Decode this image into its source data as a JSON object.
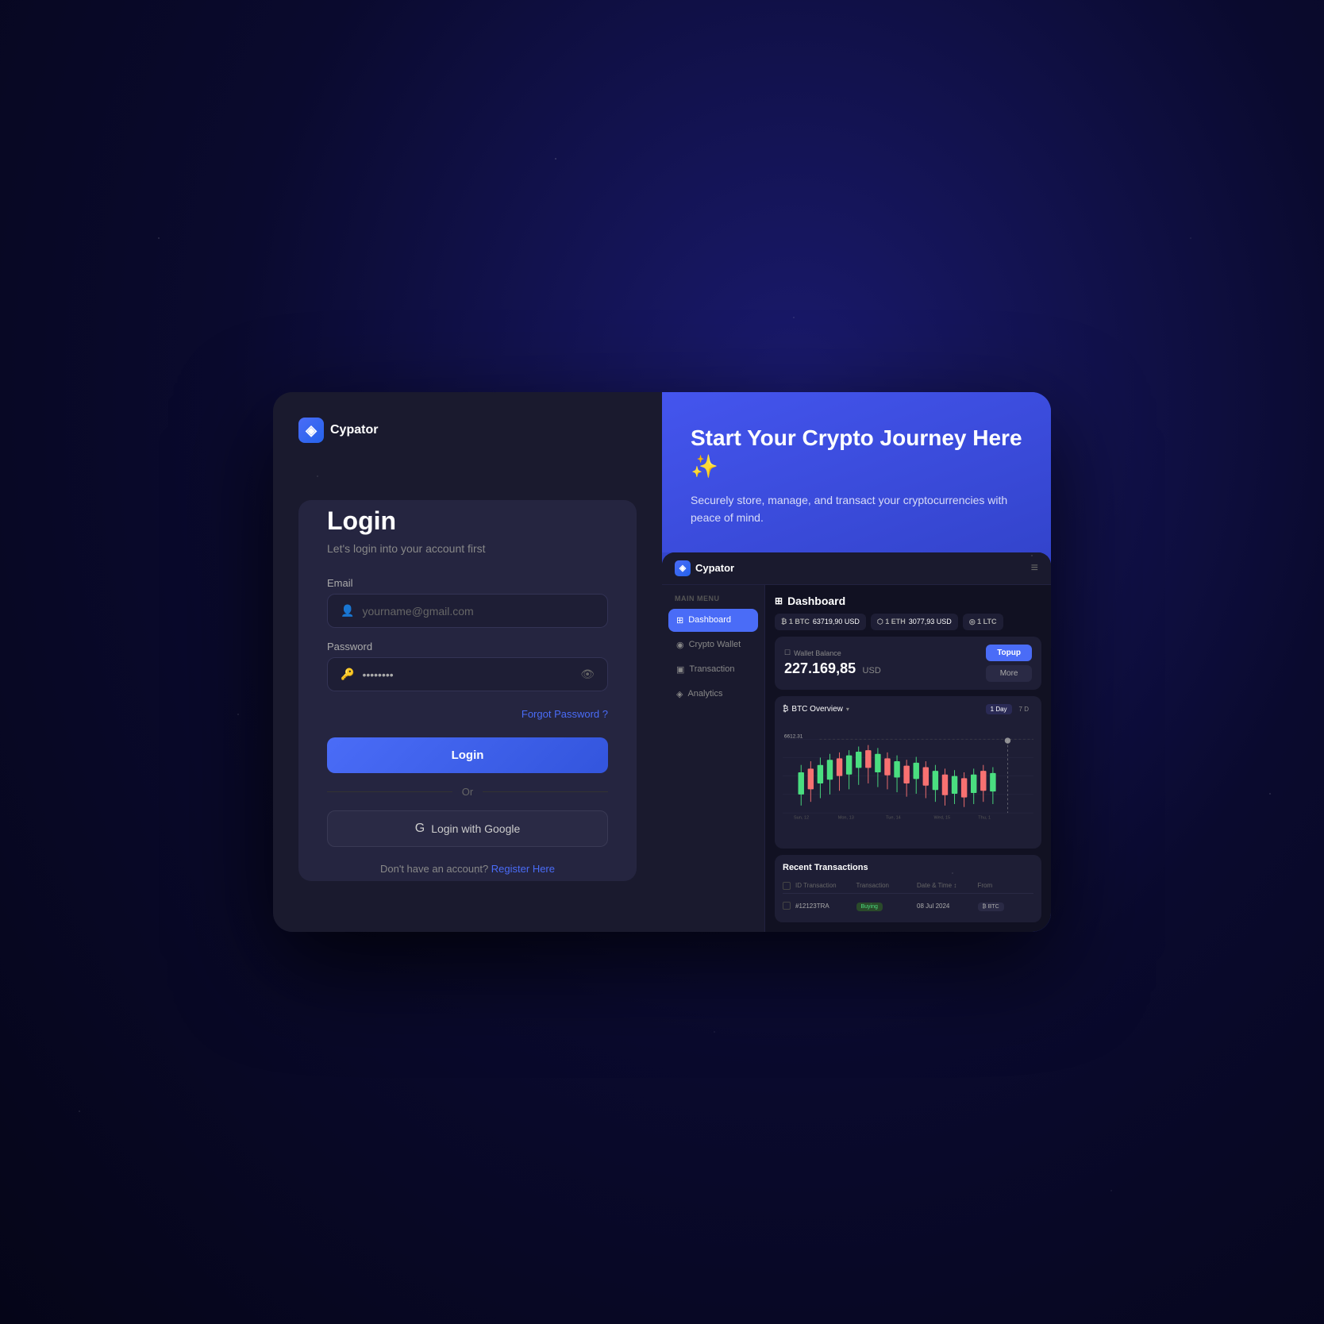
{
  "brand": {
    "name": "Cypator",
    "icon": "◈"
  },
  "login": {
    "title": "Login",
    "subtitle": "Let's login into your account first",
    "email_label": "Email",
    "email_placeholder": "yourname@gmail.com",
    "password_label": "Password",
    "password_value": "••••••••",
    "forgot_password": "Forgot Password ?",
    "login_button": "Login",
    "or_text": "Or",
    "google_button": "Login with Google",
    "no_account_text": "Don't have an account?",
    "register_link": "Register Here"
  },
  "hero": {
    "title": "Start Your Crypto Journey Here ✨",
    "subtitle": "Securely store, manage, and transact your cryptocurrencies with peace of mind."
  },
  "dashboard": {
    "title": "Dashboard",
    "title_icon": "⊞",
    "brand": "Cypator",
    "menu_section": "MAIN MENU",
    "nav_items": [
      {
        "label": "Dashboard",
        "icon": "⊞",
        "active": true
      },
      {
        "label": "Crypto Wallet",
        "icon": "◉",
        "active": false
      },
      {
        "label": "Transaction",
        "icon": "▣",
        "active": false
      },
      {
        "label": "Analytics",
        "icon": "◈",
        "active": false
      }
    ],
    "tickers": [
      {
        "coin": "₿ 1 BTC",
        "price": "63719,90 USD"
      },
      {
        "coin": "⬡ 1 ETH",
        "price": "3077,93 USD"
      },
      {
        "coin": "◎ 1 LTC",
        "price": "..."
      }
    ],
    "wallet": {
      "label": "Wallet Balance",
      "label_icon": "☐",
      "amount": "227.169,85",
      "currency": "USD",
      "topup_button": "Topup",
      "more_button": "More"
    },
    "chart": {
      "title": "BTC Overview",
      "title_icon": "₿",
      "periods": [
        "1 Day",
        "7 D"
      ],
      "active_period": "1 Day",
      "price_label": "6612.31",
      "x_labels": [
        "Sun, 12",
        "Mon, 13",
        "Tue, 14",
        "Wed, 15",
        "Thu, 16"
      ]
    },
    "transactions": {
      "title": "Recent Transactions",
      "headers": [
        "ID Transaction",
        "Transaction",
        "Date & Time",
        "From"
      ],
      "rows": [
        {
          "id": "#12123TRA",
          "type": "Buying",
          "date": "08 Jul 2024",
          "from": "₿ BTC"
        }
      ]
    }
  }
}
